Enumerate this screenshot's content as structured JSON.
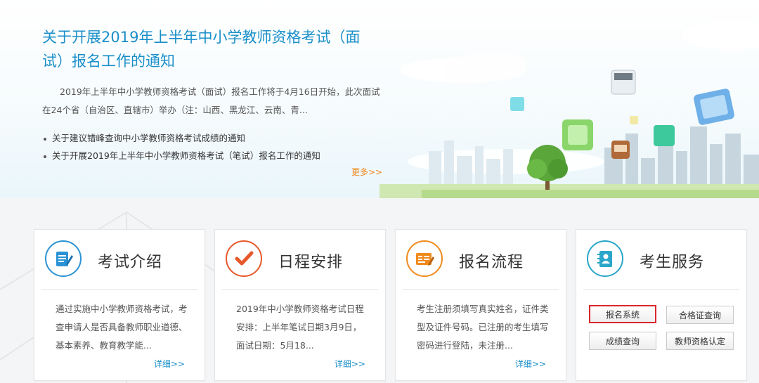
{
  "news": {
    "title": "关于开展2019年上半年中小学教师资格考试（面试）报名工作的通知",
    "summary": "2019年上半年中小学教师资格考试（面试）报名工作将于4月16日开始，此次面试在24个省（自治区、直辖市）举办（注：山西、黑龙江、云南、青...",
    "items": [
      "关于建议错峰查询中小学教师资格考试成绩的通知",
      "关于开展2019年上半年中小学教师资格考试（笔试）报名工作的通知"
    ],
    "more": "更多>>"
  },
  "cards": [
    {
      "title": "考试介绍",
      "text": "通过实施中小学教师资格考试，考查申请人是否具备教师职业道德、基本素养、教育教学能...",
      "more": "详细>>",
      "icon": "document-pen-icon",
      "color": "#2b93d5"
    },
    {
      "title": "日程安排",
      "text": "2019年中小学教师资格考试日程安排：上半年笔试日期3月9日，面试日期：5月18...",
      "more": "详细>>",
      "icon": "checkmark-icon",
      "color": "#e8582a"
    },
    {
      "title": "报名流程",
      "text": "考生注册须填写真实姓名，证件类型及证件号码。已注册的考生填写密码进行登陆，未注册...",
      "more": "详细>>",
      "icon": "form-pen-icon",
      "color": "#f08a1c"
    },
    {
      "title": "考生服务",
      "icon": "contact-book-icon",
      "color": "#2aa6c9",
      "buttons": [
        "报名系统",
        "合格证查询",
        "成绩查询",
        "教师资格认定"
      ]
    }
  ]
}
